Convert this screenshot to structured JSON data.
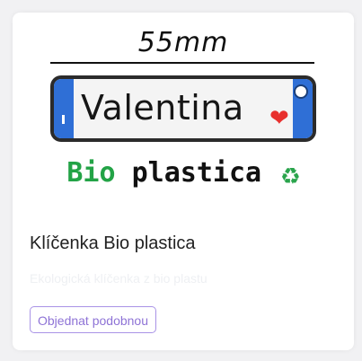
{
  "product_image": {
    "dimension": "55mm",
    "name_on_keychain": "Valentina",
    "heart_icon": "heart-icon",
    "logo_bio": "Bio",
    "logo_plastica": "plastica",
    "recycle_icon": "recycle-icon",
    "colors": {
      "keychain_ends": "#2f6fd6",
      "heart": "#e8302e",
      "bio_green": "#23a346"
    }
  },
  "card": {
    "title": "Klíčenka Bio plastica",
    "description": "Ekologická klíčenka z bio plastu",
    "order_button_label": "Objednat podobnou",
    "accent_color": "#8e73d6"
  }
}
